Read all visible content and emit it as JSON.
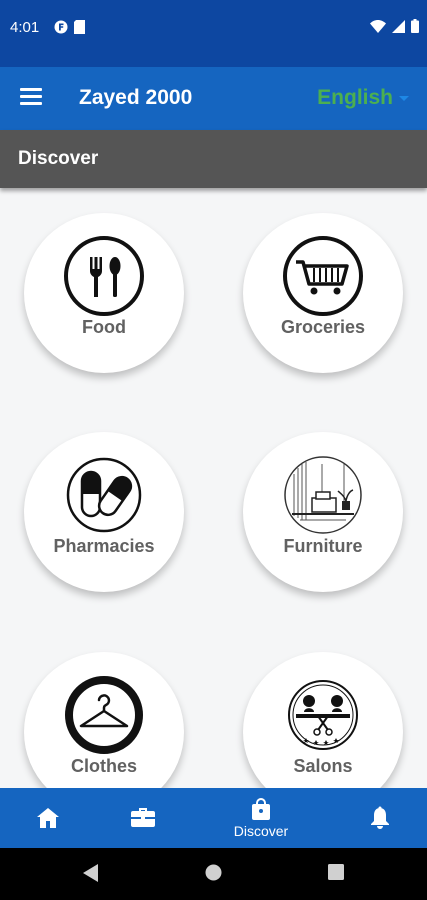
{
  "status_bar": {
    "time": "4:01"
  },
  "app_bar": {
    "title": "Zayed 2000",
    "language": "English"
  },
  "section": {
    "title": "Discover"
  },
  "categories": [
    {
      "label": "Food",
      "icon": "fork-spoon-icon"
    },
    {
      "label": "Groceries",
      "icon": "shopping-cart-icon"
    },
    {
      "label": "Pharmacies",
      "icon": "pills-icon"
    },
    {
      "label": "Furniture",
      "icon": "furniture-icon"
    },
    {
      "label": "Clothes",
      "icon": "hanger-icon"
    },
    {
      "label": "Salons",
      "icon": "salon-icon"
    }
  ],
  "bottom_nav": {
    "items": [
      {
        "icon": "home-icon",
        "label": ""
      },
      {
        "icon": "briefcase-icon",
        "label": ""
      },
      {
        "icon": "shopping-bag-icon",
        "label": "Discover",
        "active": true
      },
      {
        "icon": "bell-icon",
        "label": ""
      }
    ]
  },
  "colors": {
    "status_bar": "#0d47a1",
    "app_bar": "#1565c0",
    "language": "#4caf50",
    "section_header": "#555555"
  }
}
